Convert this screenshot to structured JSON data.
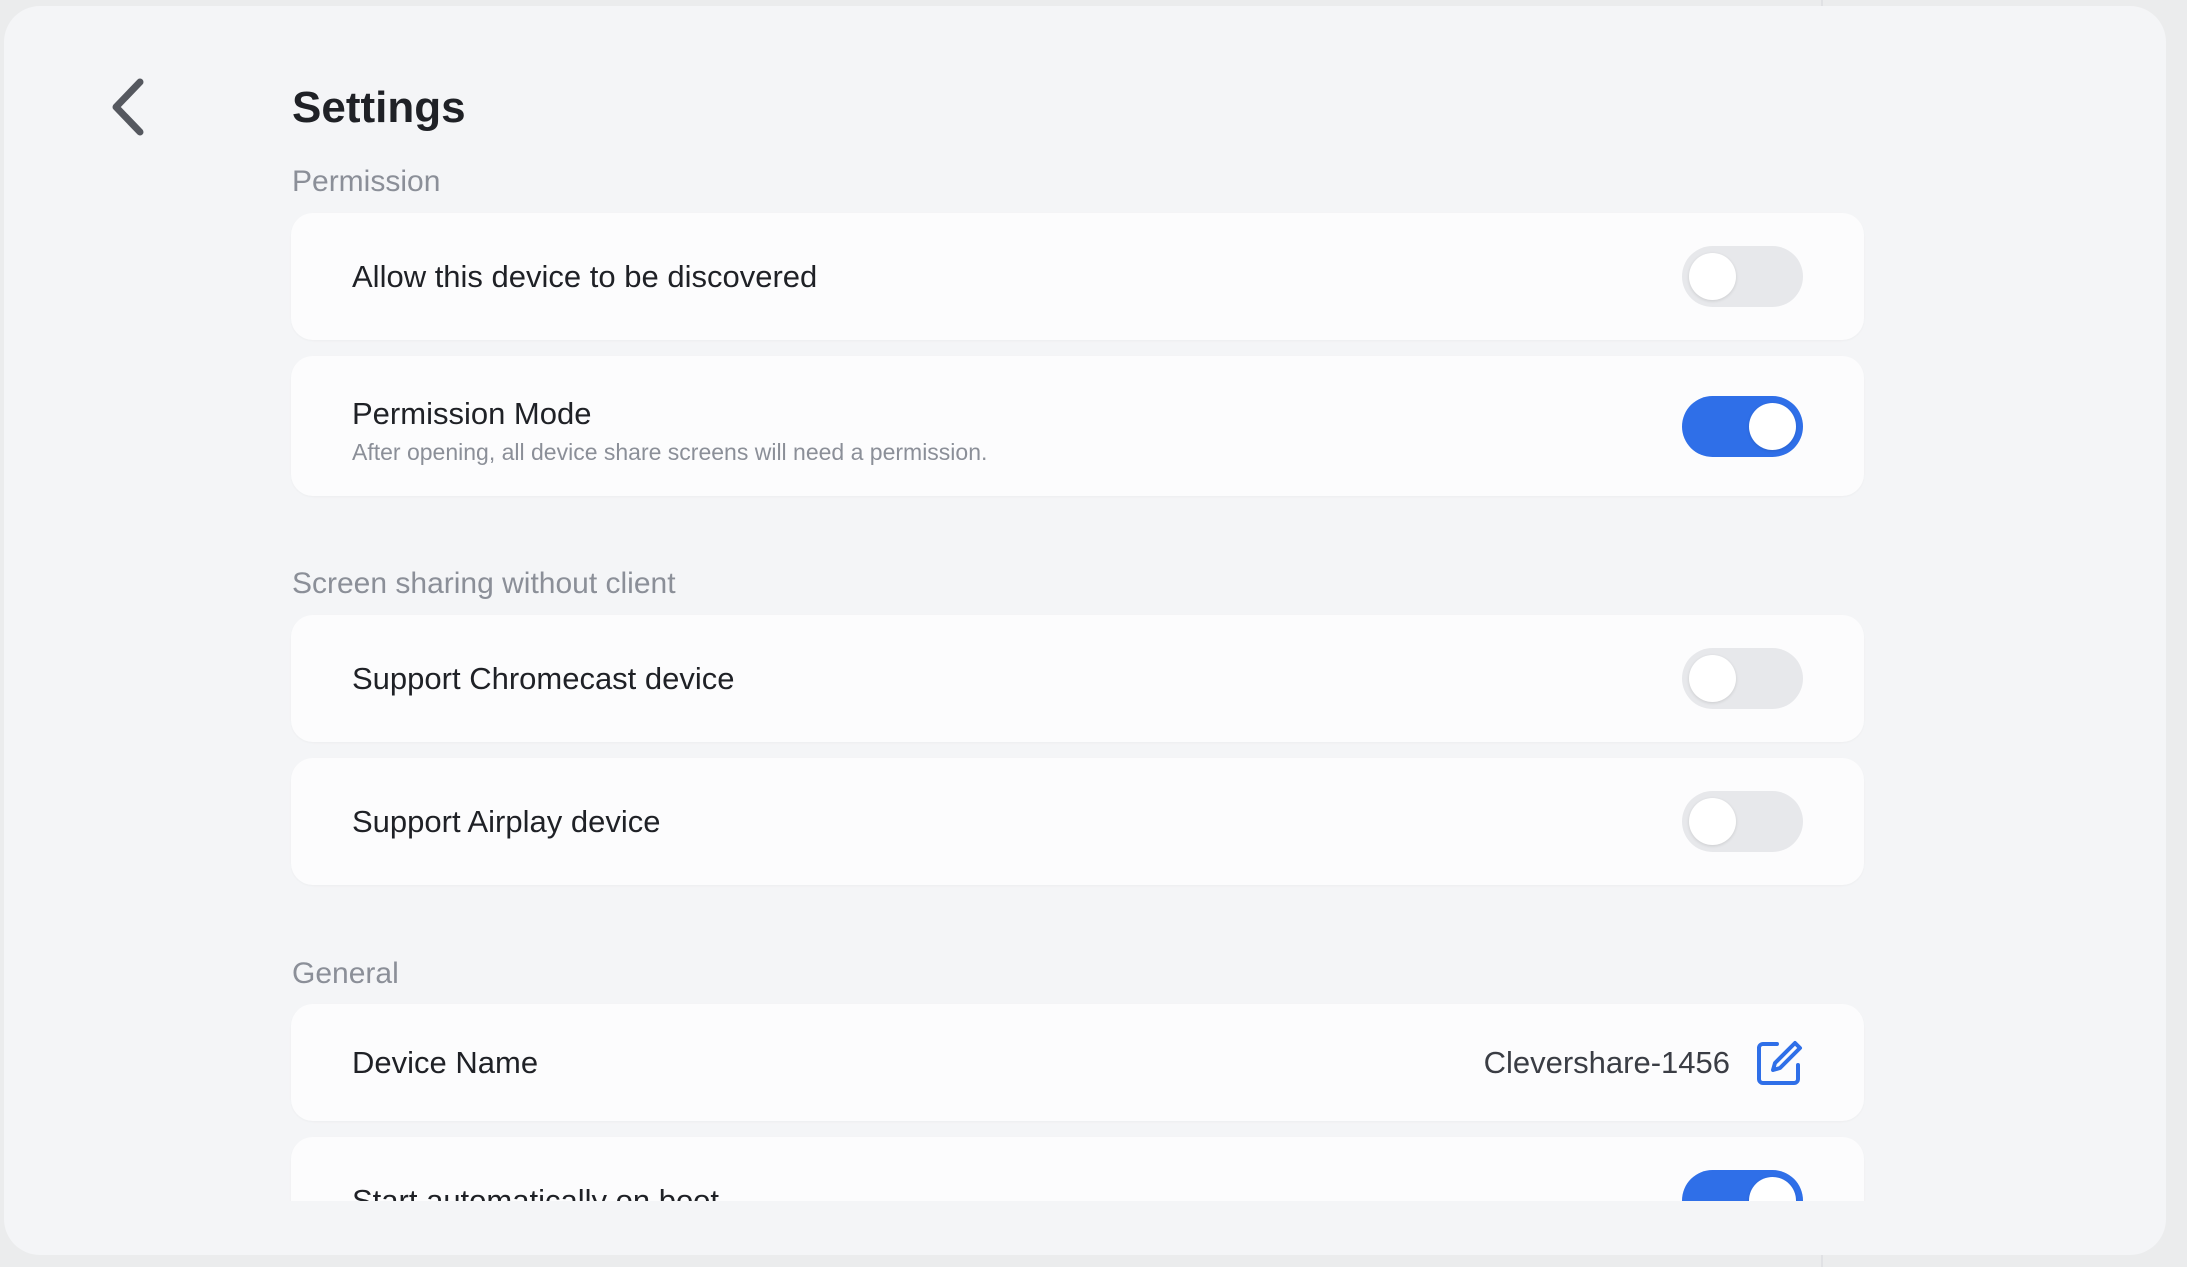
{
  "header": {
    "back_icon": "chevron-left-icon",
    "title": "Settings"
  },
  "sections": {
    "permission": {
      "label": "Permission",
      "discoverable": {
        "label": "Allow this device to be discovered",
        "enabled": false
      },
      "permission_mode": {
        "label": "Permission Mode",
        "description": "After opening, all device share screens will need a permission.",
        "enabled": true
      }
    },
    "screen_sharing": {
      "label": "Screen sharing without client",
      "chromecast": {
        "label": "Support Chromecast device",
        "enabled": false
      },
      "airplay": {
        "label": "Support Airplay device",
        "enabled": false
      }
    },
    "general": {
      "label": "General",
      "device_name": {
        "label": "Device Name",
        "value": "Clevershare-1456",
        "edit_icon": "edit-icon"
      },
      "auto_start": {
        "label": "Start automatically on boot",
        "enabled": true
      }
    }
  },
  "colors": {
    "accent": "#2f6fe8",
    "toggle_off": "#e7e8eb",
    "background": "#f4f5f7",
    "card": "#fcfcfd",
    "section_text": "#8b8f98",
    "primary_text": "#1f2126"
  }
}
